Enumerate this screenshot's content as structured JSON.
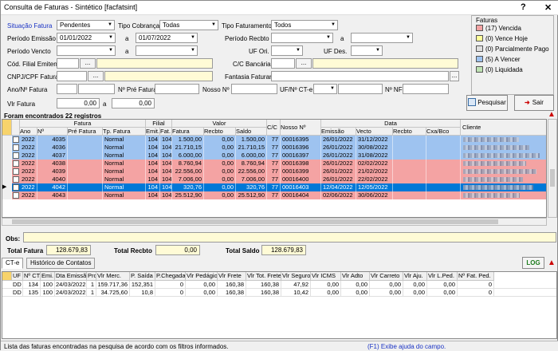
{
  "window": {
    "title": "Consulta de Faturas - Sintético [facfatsint]",
    "help": "?",
    "close": "✕"
  },
  "filters": {
    "situacao_label": "Situação Fatura",
    "situacao_value": "Pendentes",
    "tipo_cobranca_label": "Tipo Cobrança",
    "tipo_cobranca_value": "Todas",
    "tipo_faturamento_label": "Tipo Faturamento",
    "tipo_faturamento_value": "Todos",
    "periodo_emissao_label": "Período Emissão",
    "periodo_emissao_de": "01/01/2022",
    "periodo_emissao_ate": "01/07/2022",
    "a1": "a",
    "periodo_recbto_label": "Período Recbto",
    "a2": "a",
    "periodo_vencto_label": "Período Vencto",
    "a3": "a",
    "uf_ori_label": "UF Ori.",
    "uf_des_label": "UF Des.",
    "cod_filial_label": "Cód. Filial Emitente",
    "cc_bancaria_label": "C/C Bancária",
    "cnpj_label": "CNPJ/CPF Fatura",
    "fantasia_label": "Fantasia Faturar",
    "ano_fatura_label": "Ano/Nº Fatura",
    "n_pre_fatura_label": "Nº Pré Fatura",
    "nosso_n_label": "Nosso Nº",
    "uf_cte_label": "UF/Nº CT-e",
    "nf_label": "Nº NF",
    "vlr_fatura_label": "Vlr Fatura",
    "vlr_de": "0,00",
    "a4": "a",
    "vlr_ate": "0,00",
    "dots": "..."
  },
  "legend": {
    "title": "Faturas",
    "items": [
      {
        "label": "(17) Vencida",
        "color": "#f4a3a3"
      },
      {
        "label": "(0) Vence Hoje",
        "color": "#ffff99"
      },
      {
        "label": "(0) Parcialmente Pago",
        "color": "#e0e0e0"
      },
      {
        "label": "(5) A Vencer",
        "color": "#9ec3f0"
      },
      {
        "label": "(0) Liquidada",
        "color": "#bfe3b4"
      }
    ]
  },
  "buttons": {
    "pesquisar": "Pesquisar",
    "sair": "Sair",
    "log": "LOG"
  },
  "found_label": "Foram encontrados 22 registros",
  "grid": {
    "groups": {
      "fatura": "Fatura",
      "filial": "Filial",
      "valor": "Valor",
      "data": "Data"
    },
    "headers": {
      "ano": "Ano",
      "n": "Nº",
      "pre_fatura": "Pré Fatura",
      "tp_fatura": "Tp. Fatura",
      "emit": "Emit.",
      "fat": "Fat.",
      "fatura": "Fatura",
      "recbto": "Recbto",
      "saldo": "Saldo",
      "cc": "C/C",
      "nosso_n": "Nosso Nº",
      "emissao": "Emissão",
      "vencto": "Vecto",
      "recbto_d": "Recbto",
      "cxa_bco": "Cxa/Bco",
      "cliente": "Cliente"
    },
    "rows": [
      {
        "ano": "2022",
        "n": "4035",
        "tp": "Normal",
        "emit": "104",
        "fat": "104",
        "fatura": "1.500,00",
        "recbto": "0,00",
        "saldo": "1.500,00",
        "cc": "77",
        "nosso": "00016395",
        "emissao": "26/01/2022",
        "vencto": "31/12/2022",
        "color": "#9ec3f0"
      },
      {
        "ano": "2022",
        "n": "4036",
        "tp": "Normal",
        "emit": "104",
        "fat": "104",
        "fatura": "21.710,15",
        "recbto": "0,00",
        "saldo": "21.710,15",
        "cc": "77",
        "nosso": "00016396",
        "emissao": "26/01/2022",
        "vencto": "30/08/2022",
        "color": "#9ec3f0"
      },
      {
        "ano": "2022",
        "n": "4037",
        "tp": "Normal",
        "emit": "104",
        "fat": "104",
        "fatura": "6.000,00",
        "recbto": "0,00",
        "saldo": "6.000,00",
        "cc": "77",
        "nosso": "00016397",
        "emissao": "26/01/2022",
        "vencto": "31/08/2022",
        "color": "#9ec3f0"
      },
      {
        "ano": "2022",
        "n": "4038",
        "tp": "Normal",
        "emit": "104",
        "fat": "104",
        "fatura": "8.760,94",
        "recbto": "0,00",
        "saldo": "8.760,94",
        "cc": "77",
        "nosso": "00016398",
        "emissao": "26/01/2022",
        "vencto": "02/02/2022",
        "color": "#f4a3a3"
      },
      {
        "ano": "2022",
        "n": "4039",
        "tp": "Normal",
        "emit": "104",
        "fat": "104",
        "fatura": "22.556,00",
        "recbto": "0,00",
        "saldo": "22.556,00",
        "cc": "77",
        "nosso": "00016399",
        "emissao": "26/01/2022",
        "vencto": "21/02/2022",
        "color": "#f4a3a3"
      },
      {
        "ano": "2022",
        "n": "4040",
        "tp": "Normal",
        "emit": "104",
        "fat": "104",
        "fatura": "7.006,00",
        "recbto": "0,00",
        "saldo": "7.006,00",
        "cc": "77",
        "nosso": "00016400",
        "emissao": "26/01/2022",
        "vencto": "22/02/2022",
        "color": "#f4a3a3"
      },
      {
        "ano": "2022",
        "n": "4042",
        "tp": "Normal",
        "emit": "104",
        "fat": "104",
        "fatura": "320,76",
        "recbto": "0,00",
        "saldo": "320,76",
        "cc": "77",
        "nosso": "00016403",
        "emissao": "12/04/2022",
        "vencto": "12/05/2022",
        "color": "#0078d7"
      },
      {
        "ano": "2022",
        "n": "4043",
        "tp": "Normal",
        "emit": "104",
        "fat": "104",
        "fatura": "25.512,90",
        "recbto": "0,00",
        "saldo": "25.512,90",
        "cc": "77",
        "nosso": "00016404",
        "emissao": "02/06/2022",
        "vencto": "30/06/2022",
        "color": "#f4a3a3"
      }
    ]
  },
  "obs_label": "Obs:",
  "totals": {
    "fatura_label": "Total Fatura",
    "fatura": "128.679,83",
    "recbto_label": "Total Recbto",
    "recbto": "0,00",
    "saldo_label": "Total Saldo",
    "saldo": "128.679,83"
  },
  "tabs": {
    "cte": "CT-e",
    "historico": "Histórico de Contatos"
  },
  "cte_grid": {
    "headers": [
      "UF",
      "Nº CT-e",
      "Emi.",
      "Dta Emissão",
      "Pro",
      "Vlr Merc.",
      "P. Saída",
      "P.Chegada",
      "Vlr Pedágio",
      "Vlr Frete",
      "Vlr Tot. Frete",
      "Vlr Seguro",
      "Vlr ICMS",
      "Vlr Adto",
      "Vlr Carreto",
      "Vlr Aju.",
      "Vlr L.Ped.",
      "Nº Fat. Ped."
    ],
    "rows": [
      [
        "DD",
        "134",
        "100",
        "24/03/2022",
        "1",
        "159.717,36",
        "152,351",
        "0",
        "0,00",
        "160,38",
        "160,38",
        "47,92",
        "0,00",
        "0,00",
        "0,00",
        "0,00",
        "0,00",
        "0"
      ],
      [
        "DD",
        "135",
        "100",
        "24/03/2022",
        "1",
        "34.725,60",
        "10,8",
        "0",
        "0,00",
        "160,38",
        "160,38",
        "10,42",
        "0,00",
        "0,00",
        "0,00",
        "0,00",
        "0,00",
        "0"
      ]
    ]
  },
  "status": {
    "left": "Lista das faturas encontradas na pesquisa de acordo com os filtros informados.",
    "right": "(F1) Exibe ajuda do campo."
  }
}
